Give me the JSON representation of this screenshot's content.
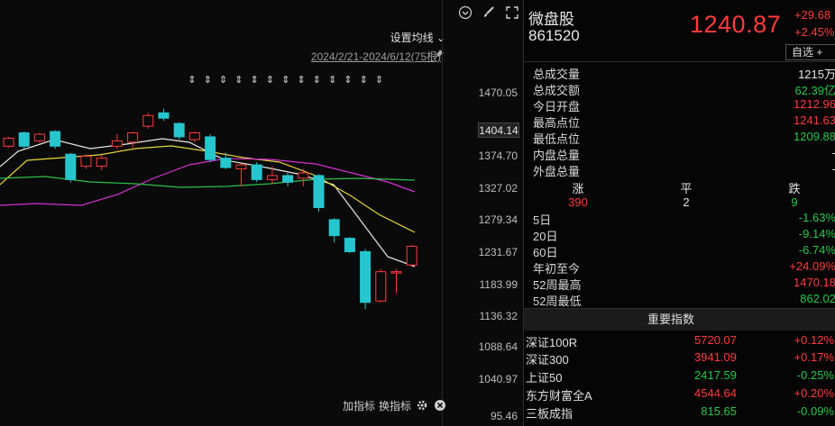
{
  "chart": {
    "ma_setting_label": "设置均线 ⌄",
    "date_range": "2024/2/21-2024/6/12(75根)",
    "current_price_tag": "1404.14",
    "y_ticks": [
      "1470.05",
      "1374.70",
      "1327.02",
      "1279.34",
      "1231.67",
      "1183.99",
      "1136.32",
      "1088.64",
      "1040.97",
      "95.46"
    ],
    "bottom_labels": {
      "add_indicator": "加指标",
      "switch_indicator": "换指标"
    },
    "icons": [
      "chevron-circle-icon",
      "brush-icon",
      "expand-icon",
      "pin-icon",
      "gear-icon",
      "close-circle-icon"
    ],
    "colors": {
      "up": "#ff3b3b",
      "down": "#26c6cf",
      "ma_white": "#e8e8e8",
      "ma_yellow": "#e6d63a",
      "ma_magenta": "#d231d2",
      "ma_green": "#2fbf4b"
    }
  },
  "chart_data": {
    "type": "candlestick",
    "ylim": [
      1040.97,
      1470.05
    ],
    "candles": [
      {
        "o": 1390,
        "c": 1402,
        "h": 1404,
        "l": 1388,
        "dir": "up"
      },
      {
        "o": 1410,
        "c": 1390,
        "h": 1412,
        "l": 1386,
        "dir": "down"
      },
      {
        "o": 1398,
        "c": 1408,
        "h": 1410,
        "l": 1395,
        "dir": "up"
      },
      {
        "o": 1412,
        "c": 1390,
        "h": 1414,
        "l": 1386,
        "dir": "down"
      },
      {
        "o": 1378,
        "c": 1340,
        "h": 1380,
        "l": 1336,
        "dir": "down"
      },
      {
        "o": 1360,
        "c": 1375,
        "h": 1378,
        "l": 1356,
        "dir": "up"
      },
      {
        "o": 1360,
        "c": 1372,
        "h": 1376,
        "l": 1354,
        "dir": "up"
      },
      {
        "o": 1390,
        "c": 1398,
        "h": 1408,
        "l": 1386,
        "dir": "up"
      },
      {
        "o": 1396,
        "c": 1410,
        "h": 1412,
        "l": 1388,
        "dir": "up"
      },
      {
        "o": 1420,
        "c": 1436,
        "h": 1440,
        "l": 1416,
        "dir": "up"
      },
      {
        "o": 1440,
        "c": 1432,
        "h": 1446,
        "l": 1428,
        "dir": "down"
      },
      {
        "o": 1424,
        "c": 1404,
        "h": 1426,
        "l": 1400,
        "dir": "down"
      },
      {
        "o": 1400,
        "c": 1410,
        "h": 1412,
        "l": 1396,
        "dir": "up"
      },
      {
        "o": 1404,
        "c": 1370,
        "h": 1408,
        "l": 1366,
        "dir": "down"
      },
      {
        "o": 1372,
        "c": 1358,
        "h": 1380,
        "l": 1356,
        "dir": "down"
      },
      {
        "o": 1362,
        "c": 1356,
        "h": 1364,
        "l": 1330,
        "dir": "up"
      },
      {
        "o": 1362,
        "c": 1340,
        "h": 1366,
        "l": 1336,
        "dir": "down"
      },
      {
        "o": 1340,
        "c": 1346,
        "h": 1360,
        "l": 1334,
        "dir": "up"
      },
      {
        "o": 1346,
        "c": 1336,
        "h": 1350,
        "l": 1330,
        "dir": "down"
      },
      {
        "o": 1342,
        "c": 1350,
        "h": 1356,
        "l": 1330,
        "dir": "up"
      },
      {
        "o": 1346,
        "c": 1298,
        "h": 1348,
        "l": 1292,
        "dir": "down"
      },
      {
        "o": 1280,
        "c": 1256,
        "h": 1282,
        "l": 1246,
        "dir": "down"
      },
      {
        "o": 1252,
        "c": 1232,
        "h": 1254,
        "l": 1230,
        "dir": "down"
      },
      {
        "o": 1232,
        "c": 1156,
        "h": 1236,
        "l": 1146,
        "dir": "down"
      },
      {
        "o": 1158,
        "c": 1202,
        "h": 1206,
        "l": 1156,
        "dir": "up"
      },
      {
        "o": 1200,
        "c": 1202,
        "h": 1206,
        "l": 1170,
        "dir": "up"
      },
      {
        "o": 1212,
        "c": 1240,
        "h": 1242,
        "l": 1210,
        "dir": "up"
      }
    ],
    "markers_count": 13
  },
  "quote": {
    "name": "微盘股",
    "code": "861520",
    "last_price": "1240.87",
    "change_abs": "+29.68",
    "change_pct": "+2.45%",
    "watch_button": "自选 +",
    "stats": [
      {
        "label": "总成交量",
        "value": "1215万",
        "color": "white"
      },
      {
        "label": "总成交额",
        "value": "62.39亿",
        "color": "green"
      },
      {
        "label": "今日开盘",
        "value": "1212.96",
        "color": "red"
      },
      {
        "label": "最高点位",
        "value": "1241.63",
        "color": "red"
      },
      {
        "label": "最低点位",
        "value": "1209.88",
        "color": "green"
      },
      {
        "label": "内盘总量",
        "value": "-",
        "color": "white"
      },
      {
        "label": "外盘总量",
        "value": "-",
        "color": "white"
      }
    ],
    "breadth": {
      "up_label": "涨",
      "flat_label": "平",
      "down_label": "跌",
      "up": "390",
      "flat": "2",
      "down": "9"
    },
    "periods": [
      {
        "label": "5日",
        "value": "-1.63%",
        "color": "green"
      },
      {
        "label": "20日",
        "value": "-9.14%",
        "color": "green"
      },
      {
        "label": "60日",
        "value": "-6.74%",
        "color": "green"
      },
      {
        "label": "年初至今",
        "value": "+24.09%",
        "color": "red"
      },
      {
        "label": "52周最高",
        "value": "1470.18",
        "color": "red"
      },
      {
        "label": "52周最低",
        "value": "862.02",
        "color": "green"
      }
    ],
    "indices_header": "重要指数",
    "indices": [
      {
        "name": "深证100R",
        "value": "5720.07",
        "pct": "+0.12%",
        "color": "red"
      },
      {
        "name": "深证300",
        "value": "3941.09",
        "pct": "+0.17%",
        "color": "red"
      },
      {
        "name": "上证50",
        "value": "2417.59",
        "pct": "-0.25%",
        "color": "green"
      },
      {
        "name": "东方财富全A",
        "value": "4544.64",
        "pct": "+0.20%",
        "color": "red"
      },
      {
        "name": "三板成指",
        "value": "815.65",
        "pct": "-0.09%",
        "color": "green"
      }
    ]
  }
}
